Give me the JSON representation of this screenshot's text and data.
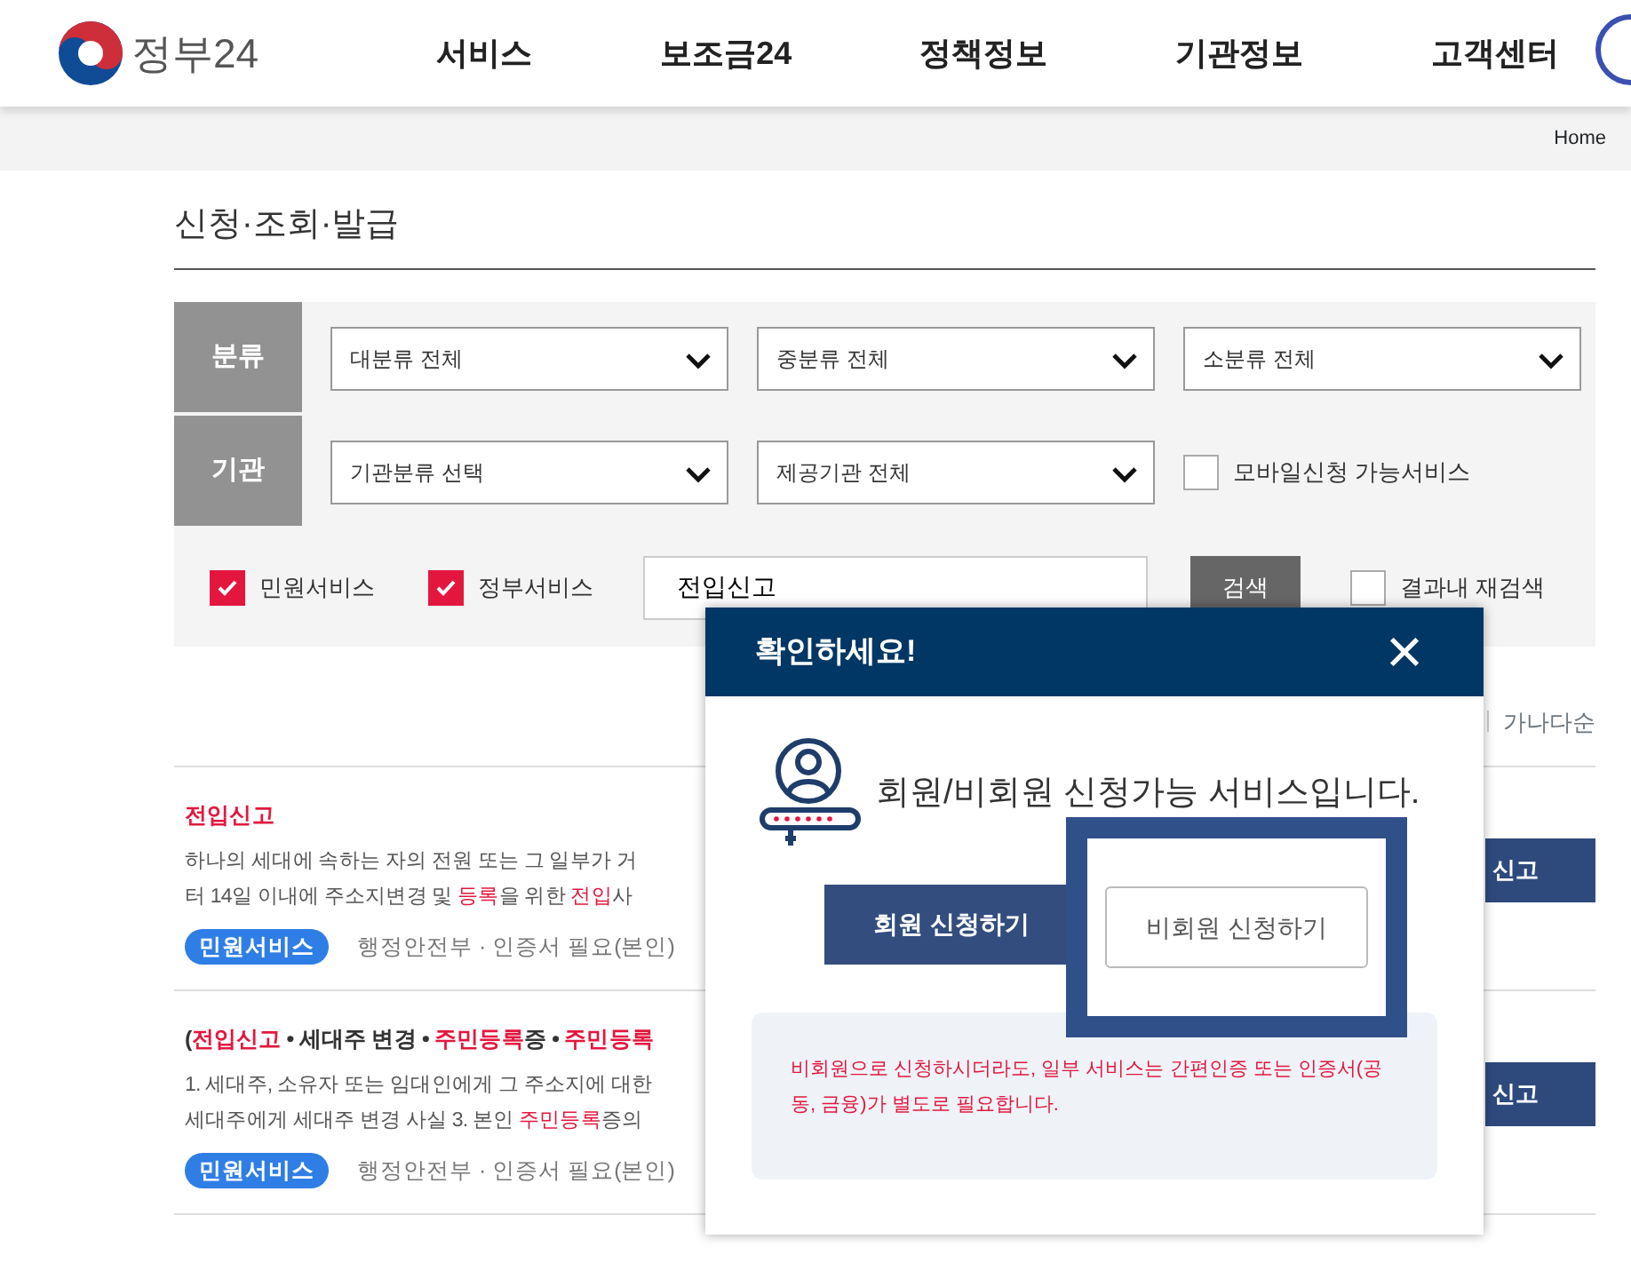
{
  "header": {
    "logo_text": "정부24",
    "nav": [
      {
        "label": "서비스",
        "selected": false
      },
      {
        "label": "보조금24",
        "selected": false
      },
      {
        "label": "정책정보",
        "selected": false
      },
      {
        "label": "기관정보",
        "selected": false
      },
      {
        "label": "고객센터",
        "selected": false
      }
    ]
  },
  "breadcrumb": "Home",
  "page_title": "신청·조회·발급",
  "filters": {
    "rows": [
      {
        "label": "분류",
        "selects": [
          "대분류 전체",
          "중분류 전체",
          "소분류 전체"
        ]
      },
      {
        "label": "기관",
        "selects": [
          "기관분류 선택",
          "제공기관 전체"
        ],
        "checkbox": {
          "label": "모바일신청 가능서비스",
          "checked": false
        }
      }
    ],
    "service_checks": [
      {
        "label": "민원서비스",
        "checked": true
      },
      {
        "label": "정부서비스",
        "checked": true
      }
    ],
    "search_value": "전입신고",
    "search_button": "검색",
    "refine": {
      "label": "결과내 재검색",
      "checked": false
    }
  },
  "sort": [
    "가나다순"
  ],
  "results": [
    {
      "title": [
        {
          "text": "전입신고",
          "highlight": true
        }
      ],
      "lines": [
        [
          {
            "text": "하나의 세대에 속하는 자의 전원 또는 그 일부가 거",
            "highlight": false
          }
        ],
        [
          {
            "text": "터 14일 이내에 주소지변경 및 ",
            "highlight": false
          },
          {
            "text": "등록",
            "highlight": true
          },
          {
            "text": "을 위한 ",
            "highlight": false
          },
          {
            "text": "전입",
            "highlight": true
          },
          {
            "text": "사",
            "highlight": false
          }
        ]
      ],
      "badge": "민원서비스",
      "meta": "행정안전부 ·  인증서 필요(본인)",
      "action": "신고"
    },
    {
      "title": [
        {
          "text": "(",
          "highlight": false
        },
        {
          "text": "전입신고",
          "highlight": true
        },
        {
          "text": " • 세대주 변경 • ",
          "highlight": false
        },
        {
          "text": "주민등록",
          "highlight": true
        },
        {
          "text": "증 • ",
          "highlight": false
        },
        {
          "text": "주민등록",
          "highlight": true
        }
      ],
      "lines": [
        [
          {
            "text": "1. 세대주, 소유자 또는 임대인에게 그 주소지에 대한",
            "highlight": false
          }
        ],
        [
          {
            "text": "세대주에게 세대주 변경 사실 3. 본인 ",
            "highlight": false
          },
          {
            "text": "주민등록",
            "highlight": true
          },
          {
            "text": "증의",
            "highlight": false
          }
        ]
      ],
      "badge": "민원서비스",
      "meta": "행정안전부 ·  인증서 필요(본인)",
      "action": "신고"
    }
  ],
  "modal": {
    "title": "확인하세요!",
    "close": "×",
    "message": "회원/비회원 신청가능 서비스입니다.",
    "buttons": [
      {
        "label": "회원 신청하기",
        "kind": "primary"
      },
      {
        "label": "비회원 신청하기",
        "kind": "outline",
        "highlighted": true
      }
    ],
    "note": "비회원으로 신청하시더라도, 일부 서비스는 간편인증 또는 인증서(공동, 금융)가 별도로 필요합니다."
  }
}
